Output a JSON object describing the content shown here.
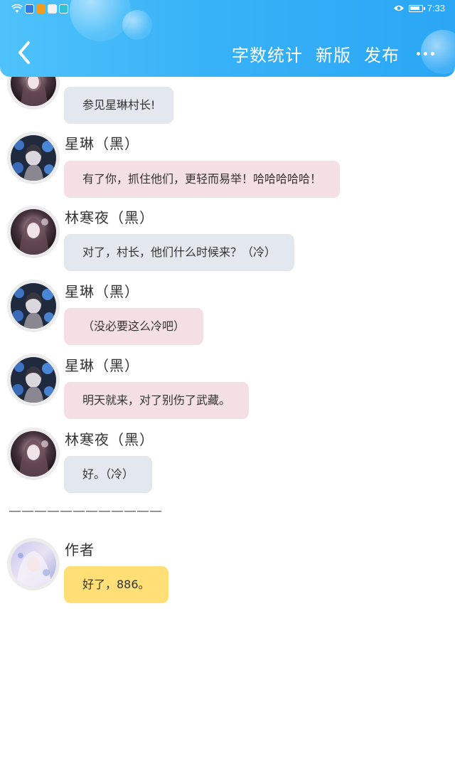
{
  "status_bar": {
    "time": "7:33"
  },
  "header": {
    "back_icon": "chevron-left-icon",
    "actions": [
      "字数统计",
      "新版",
      "发布"
    ],
    "more_icon": "more-dots-icon"
  },
  "messages": [
    {
      "name": "",
      "text": "参见星琳村长!",
      "style": "gray",
      "avatar": "avatar-linhanye"
    },
    {
      "name": "星琳（黑）",
      "text": "有了你，抓住他们，更轻而易举！哈哈哈哈哈！",
      "style": "pink",
      "avatar": "avatar-xinglin"
    },
    {
      "name": "林寒夜（黑）",
      "text": "对了，村长，他们什么时候来？（冷）",
      "style": "gray",
      "avatar": "avatar-linhanye"
    },
    {
      "name": "星琳（黑）",
      "text": "（没必要这么冷吧）",
      "style": "pink",
      "avatar": "avatar-xinglin"
    },
    {
      "name": "星琳（黑）",
      "text": "明天就来，对了别伤了武藏。",
      "style": "pink",
      "avatar": "avatar-xinglin"
    },
    {
      "name": "林寒夜（黑）",
      "text": "好。（冷）",
      "style": "gray",
      "avatar": "avatar-linhanye"
    }
  ],
  "divider": "————————————",
  "author_message": {
    "name": "作者",
    "text": "好了，886。",
    "style": "yellow",
    "avatar": "avatar-author"
  },
  "colors": {
    "header_start": "#4fc2fb",
    "header_end": "#2aa6f5",
    "bubble_gray": "#e3e7ee",
    "bubble_pink": "#f4dfe2",
    "bubble_yellow": "#ffdf76"
  }
}
